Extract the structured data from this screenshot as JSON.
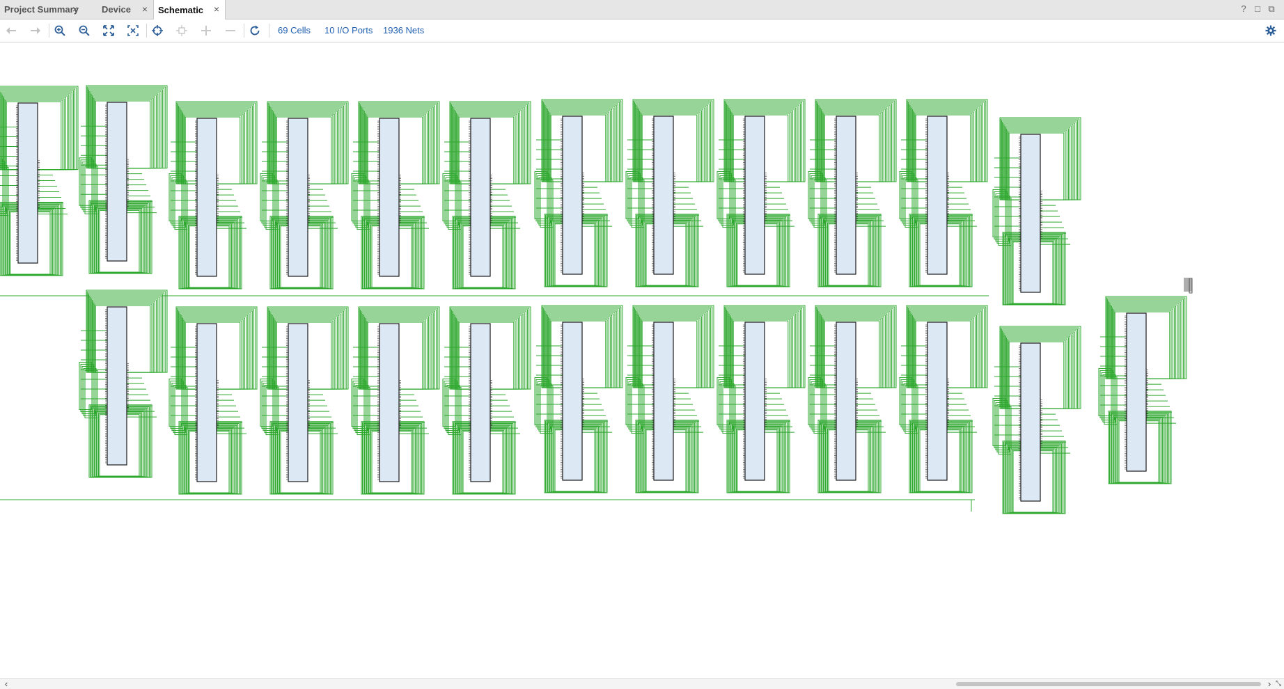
{
  "tabs": [
    {
      "label": "Project Summary",
      "active": false
    },
    {
      "label": "Device",
      "active": false
    },
    {
      "label": "Schematic",
      "active": true
    }
  ],
  "window_controls": {
    "help": "?",
    "restore": "□",
    "float": "⧉"
  },
  "toolbar": {
    "buttons": [
      {
        "name": "back-button",
        "icon": "arrow-left-icon",
        "enabled": false
      },
      {
        "name": "forward-button",
        "icon": "arrow-right-icon",
        "enabled": false
      },
      {
        "name": "zoom-in-button",
        "icon": "zoom-in-icon",
        "enabled": true
      },
      {
        "name": "zoom-out-button",
        "icon": "zoom-out-icon",
        "enabled": true
      },
      {
        "name": "zoom-fit-button",
        "icon": "fit-icon",
        "enabled": true
      },
      {
        "name": "zoom-area-button",
        "icon": "zoom-area-icon",
        "enabled": true
      },
      {
        "name": "auto-fit-selection-button",
        "icon": "crosshair-icon",
        "enabled": true
      },
      {
        "name": "regenerate-button",
        "icon": "regenerate-icon",
        "enabled": false
      },
      {
        "name": "expand-button",
        "icon": "plus-icon",
        "enabled": false
      },
      {
        "name": "collapse-button",
        "icon": "minus-icon",
        "enabled": false
      },
      {
        "name": "refresh-button",
        "icon": "refresh-icon",
        "enabled": true
      }
    ],
    "stats": {
      "cells": "69 Cells",
      "io_ports": "10 I/O Ports",
      "nets": "1936 Nets"
    },
    "settings_icon": "gear-icon"
  },
  "colors": {
    "net": "#2fa82f",
    "cell_fill": "#dde8f5",
    "cell_border": "#1a1a1a",
    "link": "#1f5fb0"
  }
}
